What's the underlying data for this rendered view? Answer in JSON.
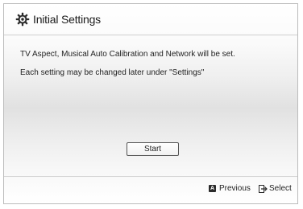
{
  "dialog": {
    "title": "Initial Settings",
    "title_icon": "gear-icon",
    "message_lines": [
      "TV Aspect, Musical Auto Calibration and Network will be set.",
      "Each setting may be changed later under \"Settings\""
    ],
    "start_label": "Start"
  },
  "footer": {
    "previous_key": "A",
    "previous_label": "Previous",
    "select_icon": "enter-icon",
    "select_label": "Select"
  },
  "colors": {
    "text": "#1f1f1f",
    "border": "#bcbcbc",
    "key_badge": "#2b2b2b"
  }
}
